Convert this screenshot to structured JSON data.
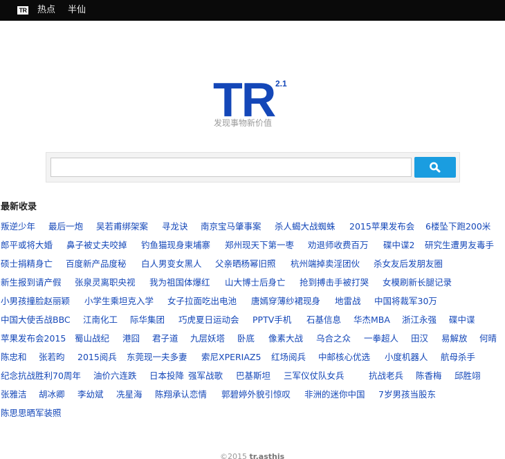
{
  "topbar": {
    "logo": "TR",
    "nav": [
      "热点",
      "半仙"
    ]
  },
  "brand": {
    "logo": "TR",
    "version": "2.1",
    "slogan": "发现事物新价值"
  },
  "search": {
    "value": "",
    "placeholder": "",
    "button_icon": "search-icon"
  },
  "section_title": "最新收录",
  "tags": [
    [
      "叛逆少年",
      "最后一炮",
      "吴若甫绑架案",
      "寻龙诀",
      "南京宝马肇事案",
      "杀人蝎大战蜘蛛",
      "2015苹果发布会",
      "6楼坠下跑200米"
    ],
    [
      "郎平或将大婚",
      "鼻子被丈夫咬掉",
      "钓鱼猫现身柬埔寨",
      "郑州现天下第一枣",
      "劝退师收费百万",
      "碟中谍2",
      "研究生遭男友毒手"
    ],
    [
      "硕士捐精身亡",
      "百度新产品度秘",
      "白人男变女黑人",
      "父亲晒杨幂旧照",
      "杭州端掉卖淫团伙",
      "杀女友后发朋友圈"
    ],
    [
      "新生报到请产假",
      "张泉灵离职央视",
      "我为祖国体爆红",
      "山大博士后身亡",
      "抢到搏击手被打哭",
      "女模刷新长腿记录"
    ],
    [
      "小男孩撞脸赵丽颖",
      "小学生乘坦克入学",
      "女子拉面吃出电池",
      "唐嫣穿薄纱裙现身",
      "地雷战",
      "中国将裁军30万"
    ],
    [
      "中国大使舌战BBC",
      "江南化工",
      "际华集团",
      "巧虎夏日运动会",
      "PPTV手机",
      "石基信息",
      "华杰MBA",
      "浙江永强",
      "碟中谍"
    ],
    [
      "苹果发布会2015",
      "蜀山战纪",
      "港囧",
      "君子道",
      "九层妖塔",
      "卧底",
      "像素大战",
      "乌合之众",
      "一拳超人",
      "田汉",
      "易解放",
      "何晴"
    ],
    [
      "陈忠和",
      "张若昀",
      "2015阅兵",
      "东莞现一夫多妻",
      "索尼XPERIAZ5",
      "红场阅兵",
      "中邮核心优选",
      "小度机器人",
      "航母杀手"
    ],
    [
      "纪念抗战胜利70周年",
      "油价六连跌",
      "日本投降",
      "强军战歌",
      "巴基斯坦",
      "三军仪仗队女兵",
      "抗战老兵",
      "陈香梅",
      "邱胜翊"
    ],
    [
      "张雅洁",
      "胡冰卿",
      "李幼斌",
      "冼星海",
      "陈翔承认恋情",
      "郭碧婷外貌引惊叹",
      "非洲的迷你中国",
      "7岁男孩当股东"
    ],
    [
      "陈思思晒军装照"
    ]
  ],
  "footer": {
    "text": "©2015 ",
    "brand": "tr.asthis"
  }
}
